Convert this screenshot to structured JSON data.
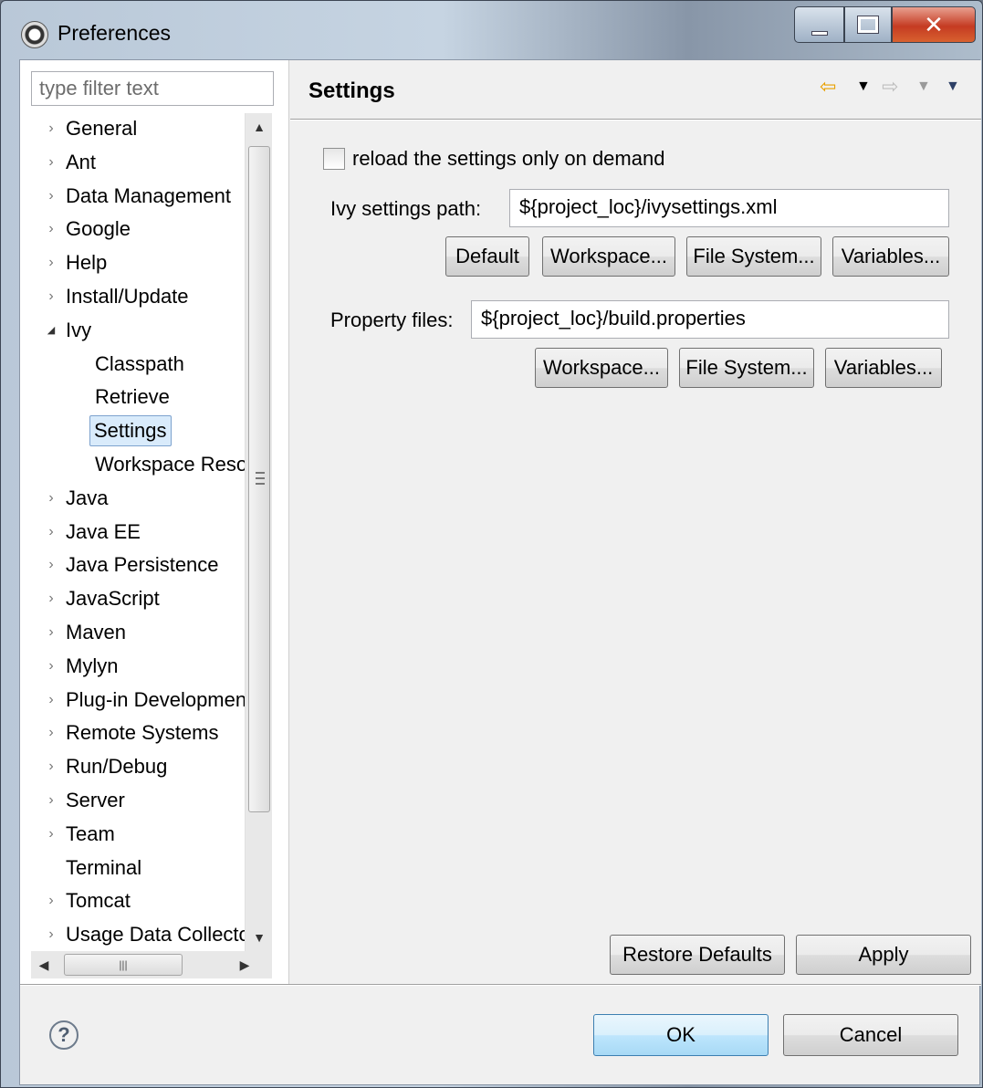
{
  "window": {
    "title": "Preferences"
  },
  "left": {
    "filter_placeholder": "type filter text",
    "tree": [
      {
        "label": "General",
        "expander": "›"
      },
      {
        "label": "Ant",
        "expander": "›"
      },
      {
        "label": "Data Management",
        "expander": "›"
      },
      {
        "label": "Google",
        "expander": "›"
      },
      {
        "label": "Help",
        "expander": "›"
      },
      {
        "label": "Install/Update",
        "expander": "›"
      },
      {
        "label": "Ivy",
        "expander": "◢"
      },
      {
        "label": "Classpath",
        "expander": ""
      },
      {
        "label": "Retrieve",
        "expander": ""
      },
      {
        "label": "Settings",
        "expander": ""
      },
      {
        "label": "Workspace Resolver",
        "expander": ""
      },
      {
        "label": "Java",
        "expander": "›"
      },
      {
        "label": "Java EE",
        "expander": "›"
      },
      {
        "label": "Java Persistence",
        "expander": "›"
      },
      {
        "label": "JavaScript",
        "expander": "›"
      },
      {
        "label": "Maven",
        "expander": "›"
      },
      {
        "label": "Mylyn",
        "expander": "›"
      },
      {
        "label": "Plug-in Development",
        "expander": "›"
      },
      {
        "label": "Remote Systems",
        "expander": "›"
      },
      {
        "label": "Run/Debug",
        "expander": "›"
      },
      {
        "label": "Server",
        "expander": "›"
      },
      {
        "label": "Team",
        "expander": "›"
      },
      {
        "label": "Terminal",
        "expander": ""
      },
      {
        "label": "Tomcat",
        "expander": "›"
      },
      {
        "label": "Usage Data Collector",
        "expander": "›"
      }
    ],
    "selected": "Settings"
  },
  "right": {
    "title": "Settings",
    "reload_checkbox": {
      "label": "reload the settings only on demand",
      "checked": false
    },
    "ivy_settings": {
      "label": "Ivy settings path:",
      "value": "${project_loc}/ivysettings.xml",
      "buttons": [
        "Default",
        "Workspace...",
        "File System...",
        "Variables..."
      ]
    },
    "property_files": {
      "label": "Property files:",
      "value": "${project_loc}/build.properties",
      "buttons": [
        "Workspace...",
        "File System...",
        "Variables..."
      ]
    },
    "restore_defaults": "Restore Defaults",
    "apply": "Apply"
  },
  "footer": {
    "ok": "OK",
    "cancel": "Cancel"
  },
  "colors": {
    "selection_bg": "#d9ebfb",
    "selection_border": "#7da2ce",
    "nav_back_arrow": "#e8a000",
    "close_button": "#c53b22"
  }
}
